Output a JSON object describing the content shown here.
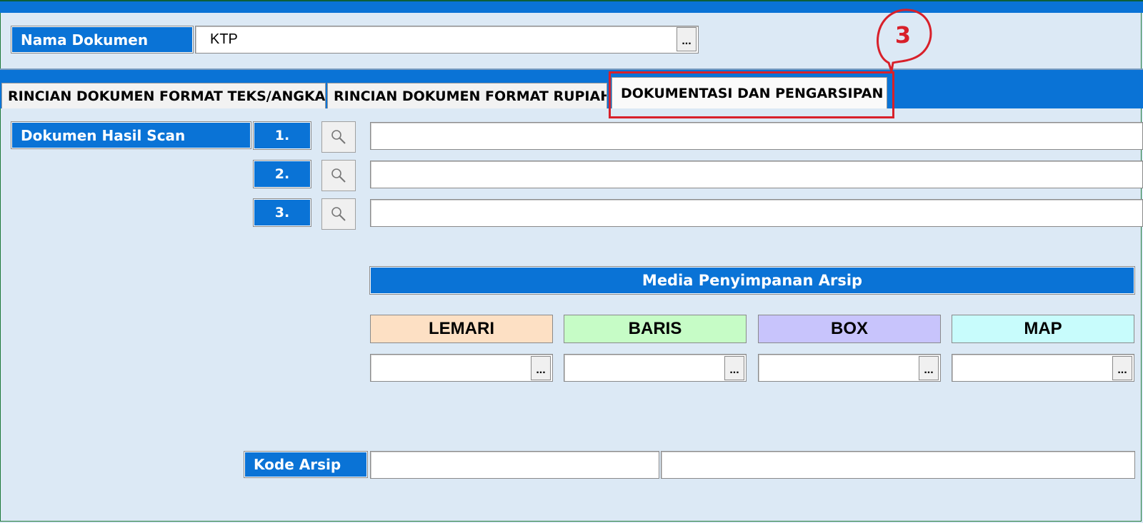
{
  "header": {
    "nama_dokumen_label": "Nama Dokumen",
    "nama_dokumen_value": "KTP",
    "browse_label": "..."
  },
  "tabs": [
    {
      "label": "RINCIAN DOKUMEN FORMAT TEKS/ANGKA",
      "active": false
    },
    {
      "label": "RINCIAN DOKUMEN FORMAT RUPIAH",
      "active": false
    },
    {
      "label": "DOKUMENTASI DAN PENGARSIPAN",
      "active": true
    }
  ],
  "annotation": {
    "number": "3",
    "color": "#d8202a"
  },
  "scan": {
    "label": "Dokumen Hasil Scan",
    "rows": [
      {
        "number": "1.",
        "value": ""
      },
      {
        "number": "2.",
        "value": ""
      },
      {
        "number": "3.",
        "value": ""
      }
    ],
    "icon": "search-icon"
  },
  "media": {
    "title": "Media Penyimpanan Arsip",
    "categories": [
      {
        "label": "LEMARI",
        "color": "#fde0c4",
        "value": ""
      },
      {
        "label": "BARIS",
        "color": "#c6fcc6",
        "value": ""
      },
      {
        "label": "BOX",
        "color": "#c8c4fc",
        "value": ""
      },
      {
        "label": "MAP",
        "color": "#c8fcfc",
        "value": ""
      }
    ],
    "browse_label": "..."
  },
  "kode_arsip": {
    "label": "Kode Arsip",
    "value1": "",
    "value2": ""
  },
  "colors": {
    "accent": "#0a73d6",
    "background": "#dce9f5"
  }
}
